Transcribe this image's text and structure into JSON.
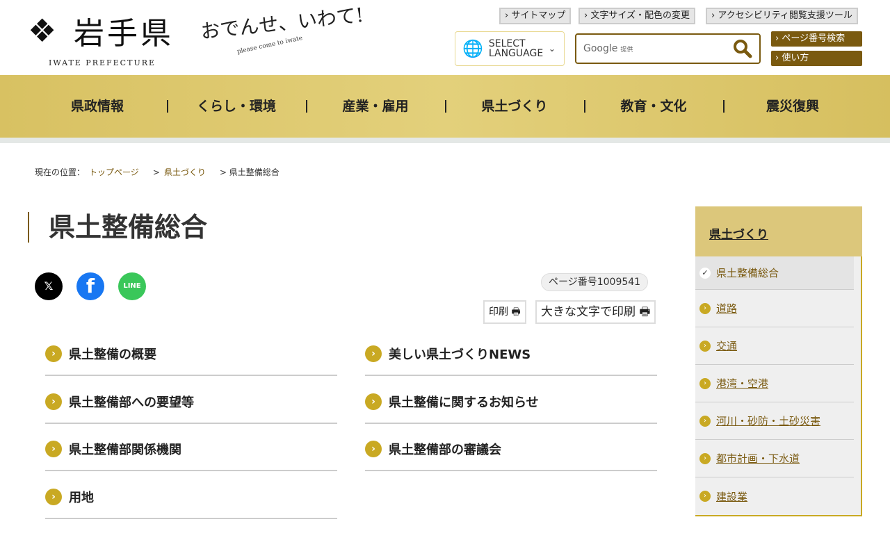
{
  "header": {
    "logo_text": "岩手県",
    "logo_sub": "IWATE PREFECTURE",
    "catch": "おでんせ、いわて!",
    "catch_sub": "please come to iwate",
    "util_links": [
      "サイトマップ",
      "文字サイズ・配色の変更",
      "アクセシビリティ閲覧支援ツール"
    ],
    "language": "SELECT LANGUAGE",
    "search_placeholder": "Google",
    "search_provider": "提供",
    "page_search": "ページ番号検索",
    "howto": "使い方"
  },
  "nav": [
    "県政情報",
    "くらし・環境",
    "産業・雇用",
    "県土づくり",
    "教育・文化",
    "震災復興"
  ],
  "breadcrumb": {
    "label": "現在の位置：",
    "items": [
      "トップページ",
      "県土づくり"
    ],
    "current": "県土整備総合"
  },
  "page": {
    "title": "県土整備総合",
    "page_number": "ページ番号1009541",
    "print": "印刷",
    "print_large": "大きな文字で印刷"
  },
  "social": [
    "X",
    "Facebook",
    "LINE"
  ],
  "links": [
    "県土整備の概要",
    "美しい県土づくりNEWS",
    "県土整備部への要望等",
    "県土整備に関するお知らせ",
    "県土整備部関係機関",
    "県土整備部の審議会",
    "用地"
  ],
  "sidebar": {
    "heading": "県土づくり",
    "current": "県土整備総合",
    "items": [
      "道路",
      "交通",
      "港湾・空港",
      "河川・砂防・土砂災害",
      "都市計画・下水道",
      "建設業"
    ]
  },
  "colors": {
    "gold": "#c9a923",
    "brown": "#7a5a10",
    "nav": "#dcc77b"
  }
}
